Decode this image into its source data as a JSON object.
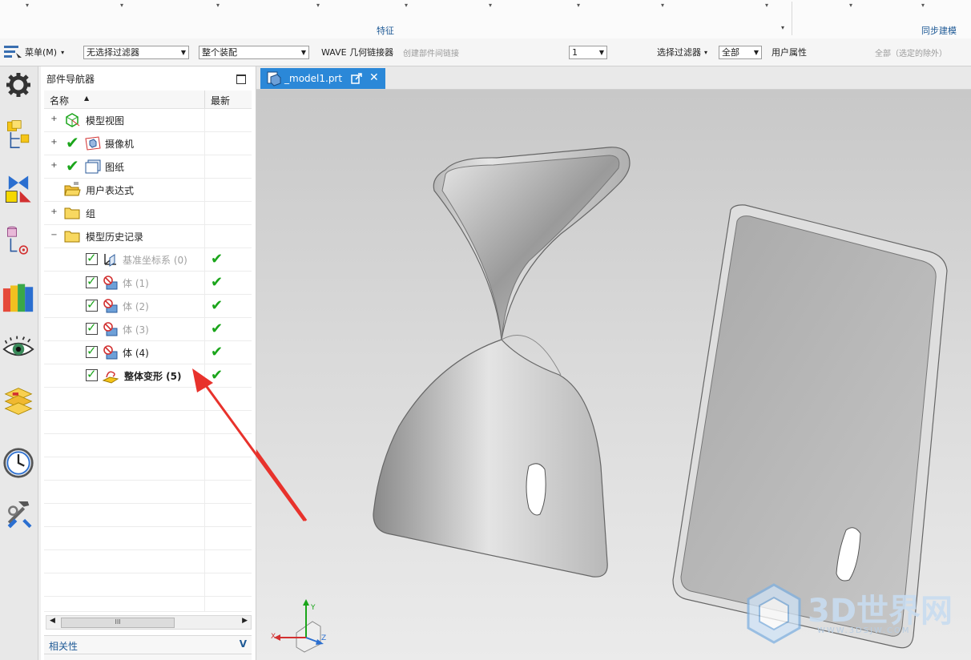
{
  "ribbon": {
    "group_features": "特征",
    "group_sync": "同步建模"
  },
  "toolbar": {
    "menu_label": "菜单(M)",
    "filter_combo": "无选择过滤器",
    "assembly_combo": "整个装配",
    "wave_label": "WAVE 几何链接器",
    "create_link_label": "创建部件间链接",
    "level_combo": "1",
    "select_filter_label": "选择过滤器",
    "all_combo": "全部",
    "user_attr_label": "用户属性",
    "all_except_label": "全部（选定的除外）"
  },
  "navigator": {
    "title": "部件导航器",
    "col_name": "名称",
    "col_latest": "最新",
    "rows": [
      {
        "label": "模型视图",
        "expander": "+",
        "checked": false,
        "icon": "model-view-icon",
        "style": "normal"
      },
      {
        "label": "摄像机",
        "expander": "+",
        "checked": true,
        "icon": "camera-icon",
        "style": "normal"
      },
      {
        "label": "图纸",
        "expander": "+",
        "checked": true,
        "icon": "drawing-icon",
        "style": "normal"
      },
      {
        "label": "用户表达式",
        "expander": "",
        "checked": false,
        "icon": "open-folder-icon",
        "style": "normal"
      },
      {
        "label": "组",
        "expander": "+",
        "checked": false,
        "icon": "folder-icon",
        "style": "normal"
      },
      {
        "label": "模型历史记录",
        "expander": "−",
        "checked": false,
        "icon": "folder-icon",
        "style": "normal"
      },
      {
        "label": "基准坐标系 (0)",
        "expander": "",
        "checked": true,
        "icon": "datum-csys-icon",
        "style": "dim",
        "latest": "✔"
      },
      {
        "label": "体 (1)",
        "expander": "",
        "checked": true,
        "icon": "body-icon",
        "style": "dim",
        "latest": "✔"
      },
      {
        "label": "体 (2)",
        "expander": "",
        "checked": true,
        "icon": "body-icon",
        "style": "dim",
        "latest": "✔"
      },
      {
        "label": "体 (3)",
        "expander": "",
        "checked": true,
        "icon": "body-icon",
        "style": "dim",
        "latest": "✔"
      },
      {
        "label": "体 (4)",
        "expander": "",
        "checked": true,
        "icon": "body-icon",
        "style": "normal",
        "latest": "✔"
      },
      {
        "label": "整体变形 (5)",
        "expander": "",
        "checked": true,
        "icon": "global-shaping-icon",
        "style": "bold",
        "latest": "✔"
      }
    ],
    "related_label": "相关性",
    "related_chevron": "V"
  },
  "graphics": {
    "tab_label": "_model1.prt",
    "axis_labels": {
      "x": "X",
      "y": "Y",
      "z": "Z"
    },
    "watermark_brand": "3D世界网",
    "watermark_url": "WWW.3DSJW.COM"
  },
  "colors": {
    "accent_blue": "#2b88d8",
    "check_green": "#1aa51a",
    "annotation_red": "#e8322c",
    "viewport_top": "#c8c8c8",
    "viewport_bottom": "#ebebeb"
  }
}
